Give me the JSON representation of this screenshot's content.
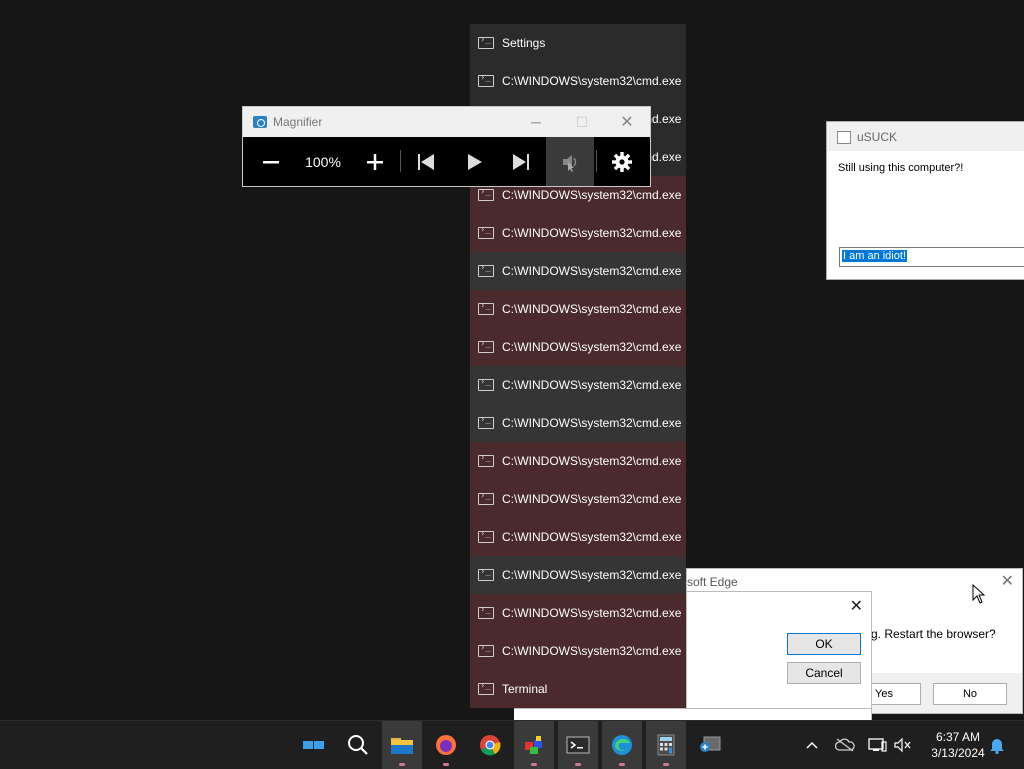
{
  "jumplist": {
    "items": [
      {
        "label": "Settings",
        "style": "plain"
      },
      {
        "label": "C:\\WINDOWS\\system32\\cmd.exe",
        "style": "plain"
      },
      {
        "label": "C:\\WINDOWS\\system32\\cmd.exe",
        "style": "plain"
      },
      {
        "label": "C:\\WINDOWS\\system32\\cmd.exe",
        "style": "plain"
      },
      {
        "label": "C:\\WINDOWS\\system32\\cmd.exe",
        "style": "red"
      },
      {
        "label": "C:\\WINDOWS\\system32\\cmd.exe",
        "style": "red"
      },
      {
        "label": "C:\\WINDOWS\\system32\\cmd.exe",
        "style": "dark"
      },
      {
        "label": "C:\\WINDOWS\\system32\\cmd.exe",
        "style": "red"
      },
      {
        "label": "C:\\WINDOWS\\system32\\cmd.exe",
        "style": "red"
      },
      {
        "label": "C:\\WINDOWS\\system32\\cmd.exe",
        "style": "dark"
      },
      {
        "label": "C:\\WINDOWS\\system32\\cmd.exe",
        "style": "dark"
      },
      {
        "label": "C:\\WINDOWS\\system32\\cmd.exe",
        "style": "red"
      },
      {
        "label": "C:\\WINDOWS\\system32\\cmd.exe",
        "style": "red"
      },
      {
        "label": "C:\\WINDOWS\\system32\\cmd.exe",
        "style": "red"
      },
      {
        "label": "C:\\WINDOWS\\system32\\cmd.exe",
        "style": "dark"
      },
      {
        "label": "C:\\WINDOWS\\system32\\cmd.exe",
        "style": "red"
      },
      {
        "label": "C:\\WINDOWS\\system32\\cmd.exe",
        "style": "red"
      },
      {
        "label": "Terminal",
        "style": "red"
      }
    ]
  },
  "magnifier": {
    "title": "Magnifier",
    "zoom": "100%",
    "minimize_glyph": "─",
    "maximize_glyph": "☐",
    "close_glyph": "✕"
  },
  "usuck": {
    "title": "uSUCK",
    "message": "Still using this computer?!",
    "input_value": "I am an idiot!"
  },
  "edge_dialog": {
    "title": "soft Edge",
    "message": "g. Restart the browser?",
    "yes": "Yes",
    "no": "No",
    "close_glyph": "✕"
  },
  "ok_dialog": {
    "ok": "OK",
    "cancel": "Cancel",
    "close_glyph": "✕"
  },
  "taskbar": {
    "time": "6:37 AM",
    "date": "3/13/2024"
  },
  "colors": {
    "accent": "#0078d7",
    "jumplist_red": "#4a2a2c",
    "taskbar": "#1f1f1f"
  }
}
